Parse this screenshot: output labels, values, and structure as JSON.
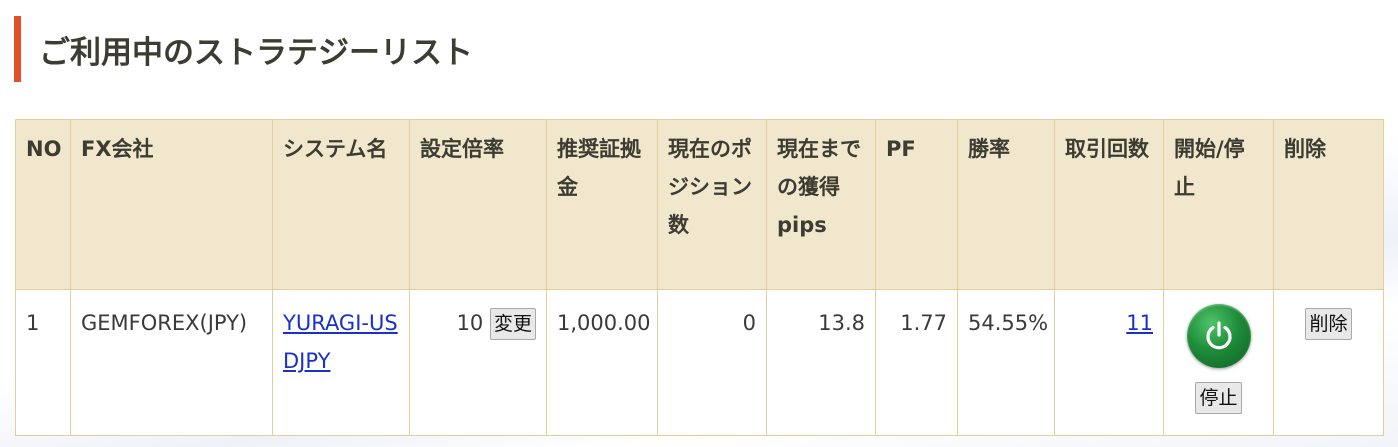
{
  "page": {
    "title": "ご利用中のストラテジーリスト"
  },
  "table": {
    "headers": {
      "no": "NO",
      "fx_company": "FX会社",
      "system_name": "システム名",
      "leverage": "設定倍率",
      "recommended_margin": "推奨証拠金",
      "current_position_count": "現在のポジション数",
      "pips_to_date": "現在までの獲得pips",
      "pf": "PF",
      "win_rate": "勝率",
      "trade_count": "取引回数",
      "start_stop": "開始/停止",
      "delete": "削除"
    },
    "rows": [
      {
        "no": "1",
        "fx_company": "GEMFOREX(JPY)",
        "system_name": "YURAGI-USDJPY",
        "leverage": "10",
        "change_label": "変更",
        "recommended_margin": "1,000.00",
        "current_position_count": "0",
        "pips_to_date": "13.8",
        "pf": "1.77",
        "win_rate": "54.55%",
        "trade_count": "11",
        "stop_label": "停止",
        "delete_label": "削除"
      }
    ]
  },
  "icons": {
    "power": "power-icon"
  },
  "colors": {
    "accent_bar": "#e2502a",
    "header_bg": "#f1e7cd",
    "border": "#e3cf9a",
    "link": "#1a31c9",
    "power_green": "#1e8d3a"
  }
}
